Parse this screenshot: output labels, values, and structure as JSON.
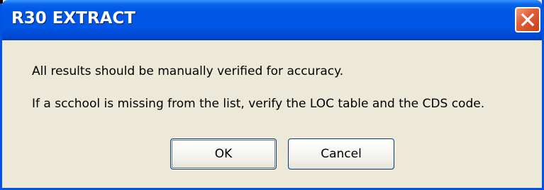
{
  "window": {
    "title": "R30 EXTRACT"
  },
  "message": {
    "line1": "All results should be manually verified for accuracy.",
    "line2": "If a scchool is missing from the list, verify the LOC table and the CDS code."
  },
  "buttons": {
    "ok_label": "OK",
    "cancel_label": "Cancel"
  },
  "icons": {
    "close": "close-icon"
  },
  "colors": {
    "titlebar": "#0055e5",
    "window_border": "#0054e3",
    "dialog_background": "#ece9d8",
    "close_button": "#e0603a",
    "button_border": "#003c74"
  }
}
